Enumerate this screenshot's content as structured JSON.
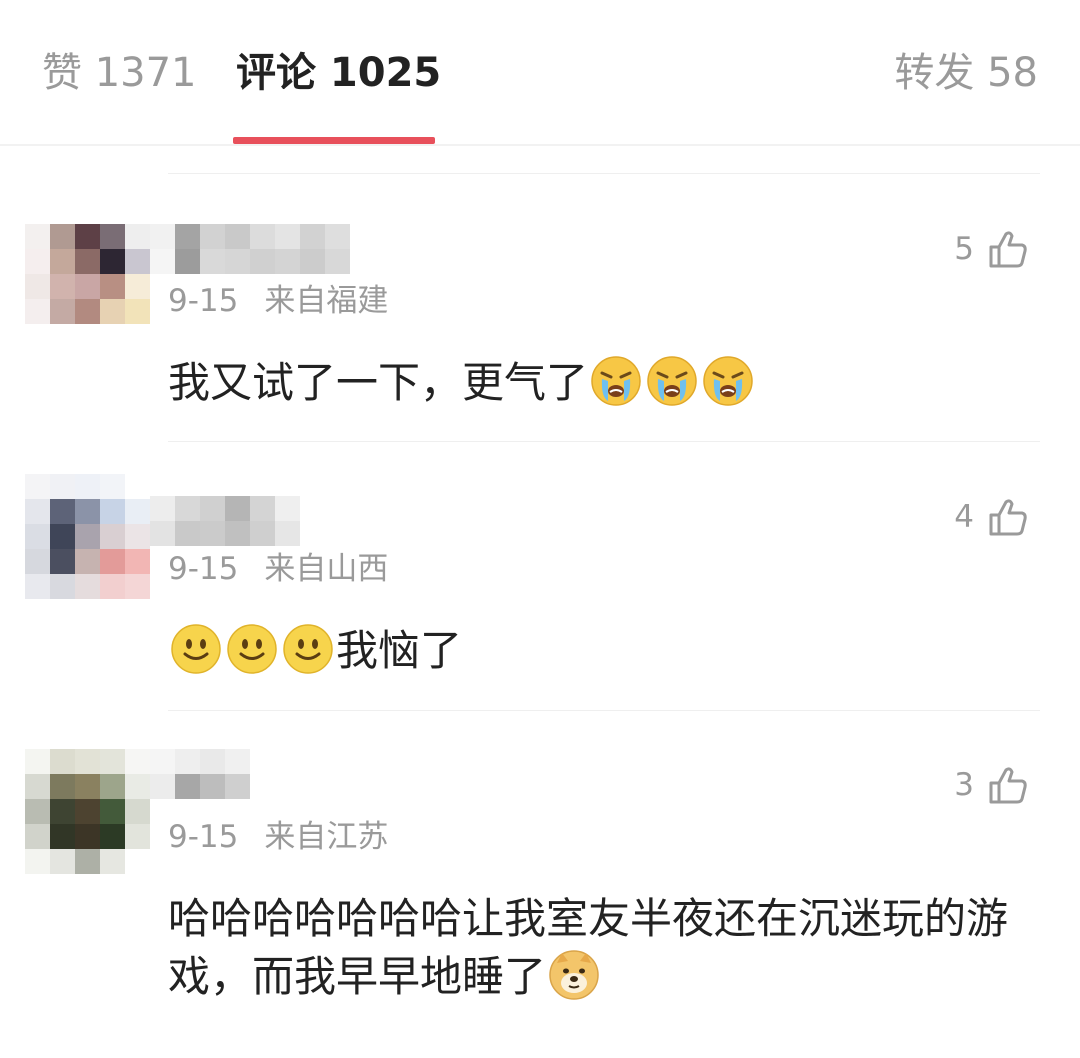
{
  "tabs": {
    "likes": "赞 1371",
    "comments": "评论 1025",
    "reposts": "转发 58",
    "active_color": "#e8505b"
  },
  "comments": [
    {
      "date": "9-15",
      "location": "来自福建",
      "likes": "5",
      "text": "我又试了一下，更气了",
      "emoji_after": [
        "crying-face-emoji",
        "crying-face-emoji",
        "crying-face-emoji"
      ]
    },
    {
      "date": "9-15",
      "location": "来自山西",
      "likes": "4",
      "emoji_before": [
        "smiley-face-emoji",
        "smiley-face-emoji",
        "smiley-face-emoji"
      ],
      "text": "我恼了"
    },
    {
      "date": "9-15",
      "location": "来自江苏",
      "likes": "3",
      "text": "哈哈哈哈哈哈哈让我室友半夜还在沉迷玩的游戏，而我早早地睡了",
      "emoji_after": [
        "doge-emoji"
      ]
    }
  ],
  "icons": {
    "like": "thumbs-up-icon"
  }
}
